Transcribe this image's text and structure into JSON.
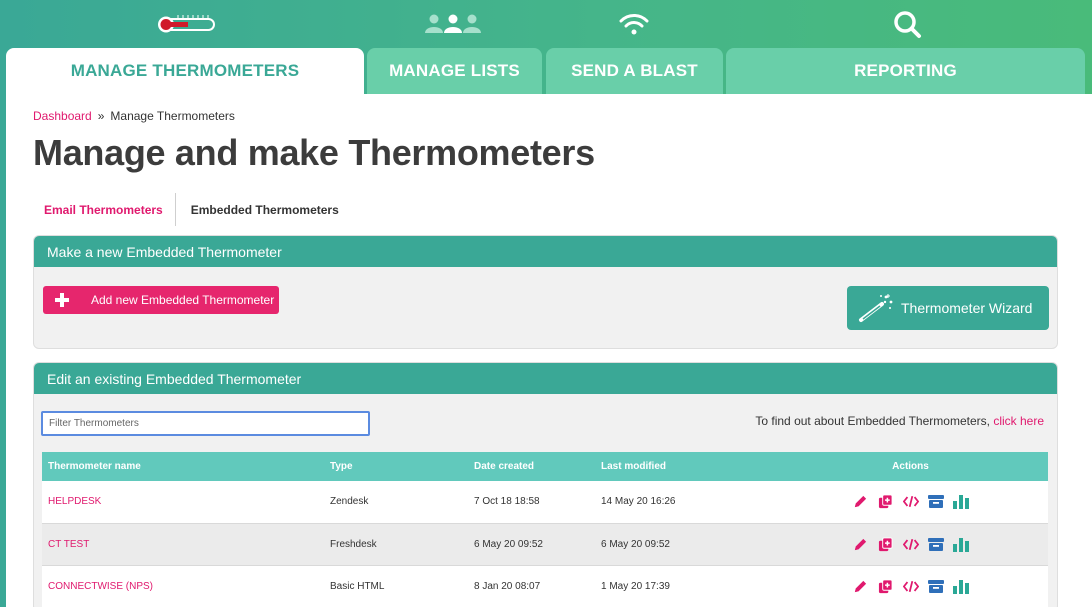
{
  "colors": {
    "accent_pink": "#e0196e",
    "teal": "#3aa896",
    "tab_inactive": "#69cfa9",
    "table_header": "#61c9bc",
    "archive_blue": "#2f6fb9",
    "stats_teal": "#2aa896"
  },
  "top_icons": [
    "thermometer-icon",
    "users-icon",
    "wifi-icon",
    "search-icon"
  ],
  "tabs": [
    {
      "label": "MANAGE THERMOMETERS",
      "active": true
    },
    {
      "label": "MANAGE LISTS",
      "active": false
    },
    {
      "label": "SEND A BLAST",
      "active": false
    },
    {
      "label": "REPORTING",
      "active": false
    }
  ],
  "breadcrumb": {
    "home": "Dashboard",
    "separator": "»",
    "current": "Manage Thermometers"
  },
  "page_title": "Manage and make Thermometers",
  "subtabs": [
    {
      "label": "Email Thermometers",
      "active": true
    },
    {
      "label": "Embedded Thermometers",
      "active": false
    }
  ],
  "new_card": {
    "title": "Make a new Embedded Thermometer",
    "add_button": "Add new Embedded Thermometer",
    "wizard_button": "Thermometer Wizard"
  },
  "edit_card": {
    "title": "Edit an existing Embedded Thermometer",
    "filter_placeholder": "Filter Thermometers",
    "info_text": "To find out about Embedded Thermometers,",
    "info_link": "click here"
  },
  "table": {
    "columns": [
      "Thermometer name",
      "Type",
      "Date created",
      "Last modified",
      "Actions"
    ],
    "rows": [
      {
        "name": "HELPDESK",
        "type": "Zendesk",
        "created": "7 Oct 18 18:58",
        "modified": "14 May 20 16:26"
      },
      {
        "name": "CT TEST",
        "type": "Freshdesk",
        "created": "6 May 20 09:52",
        "modified": "6 May 20 09:52"
      },
      {
        "name": "CONNECTWISE (NPS)",
        "type": "Basic HTML",
        "created": "8 Jan 20 08:07",
        "modified": "1 May 20 17:39"
      }
    ],
    "action_icons": [
      "edit-icon",
      "copy-icon",
      "code-icon",
      "archive-icon",
      "stats-icon"
    ]
  }
}
